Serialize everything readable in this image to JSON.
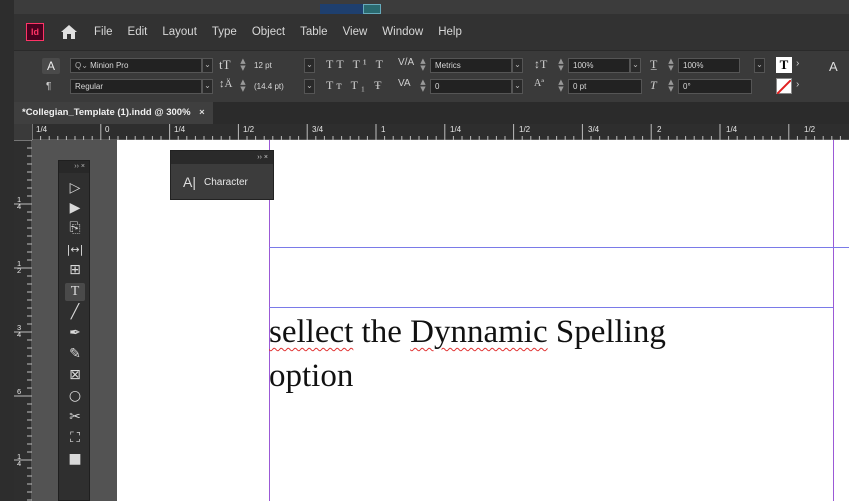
{
  "menubar": {
    "logo": "Id",
    "items": [
      "File",
      "Edit",
      "Layout",
      "Type",
      "Object",
      "Table",
      "View",
      "Window",
      "Help"
    ]
  },
  "control": {
    "font_family": "Minion Pro",
    "font_style": "Regular",
    "font_size": "12 pt",
    "leading": "(14.4 pt)",
    "kerning": "Metrics",
    "tracking": "0",
    "vertical_scale": "100%",
    "horizontal_scale": "100%",
    "baseline_shift": "0 pt",
    "skew": "0°",
    "case_buttons": [
      "TT",
      "T¹",
      "T",
      "Tт",
      "T₁",
      "T"
    ]
  },
  "document": {
    "tab_title": "*Collegian_Template (1).indd @ 300%",
    "close": "×"
  },
  "rulers": {
    "horizontal": [
      "1/4",
      "0",
      "1/4",
      "1/2",
      "3/4",
      "1",
      "1/4",
      "1/2",
      "3/4",
      "2",
      "1/4",
      "1/2"
    ],
    "vertical": [
      {
        "top": "1",
        "bottom": "4"
      },
      {
        "top": "1",
        "bottom": "2"
      },
      {
        "top": "3",
        "bottom": "4"
      },
      {
        "top": "6",
        "bottom": ""
      },
      {
        "top": "1",
        "bottom": "4"
      }
    ]
  },
  "character_panel": {
    "label": "Character",
    "controls": "›› ×"
  },
  "tools_panel": {
    "controls": "›› ×"
  },
  "page_text": {
    "word1": "sellect",
    "word2": " the ",
    "word3": "Dynnamic",
    "word4": " Spelling",
    "line2": "option"
  },
  "colors": {
    "app_bg": "#323232",
    "margin_guide": "#9b59d6",
    "spell_underline": "#e03030"
  }
}
